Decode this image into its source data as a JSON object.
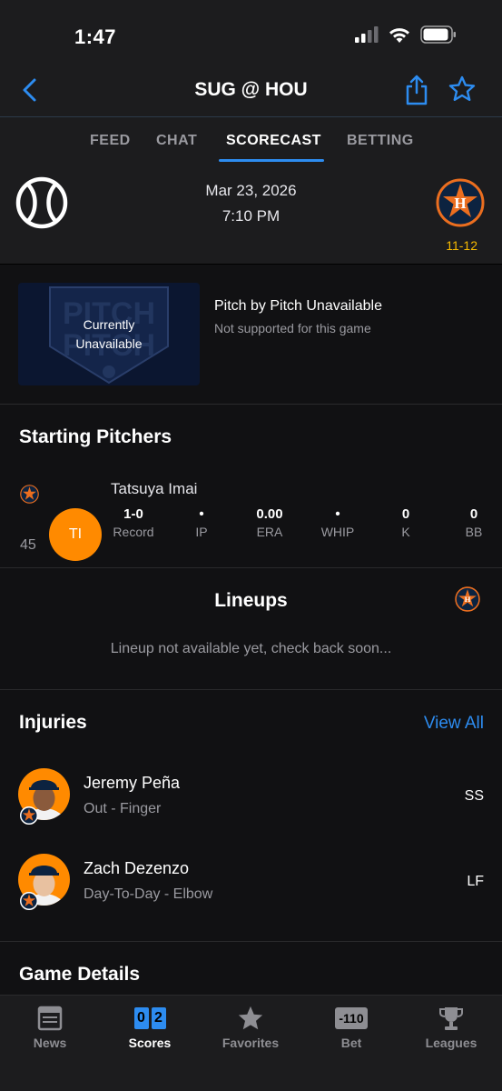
{
  "status_bar": {
    "time": "1:47"
  },
  "nav": {
    "title": "SUG @ HOU"
  },
  "tabs": [
    {
      "label": "FEED"
    },
    {
      "label": "CHAT"
    },
    {
      "label": "SCORECAST"
    },
    {
      "label": "BETTING"
    }
  ],
  "game": {
    "date": "Mar 23, 2026",
    "time": "7:10 PM",
    "home_record": "11-12"
  },
  "pitch_by_pitch": {
    "overlay": "Currently Unavailable",
    "title": "Pitch by Pitch Unavailable",
    "subtitle": "Not supported for this game"
  },
  "starting_pitchers": {
    "heading": "Starting Pitchers",
    "pitcher": {
      "name": "Tatsuya Imai",
      "initials": "TI",
      "number": "45",
      "stats": [
        {
          "value": "1-0",
          "label": "Record"
        },
        {
          "value": "•",
          "label": "IP"
        },
        {
          "value": "0.00",
          "label": "ERA"
        },
        {
          "value": "•",
          "label": "WHIP"
        },
        {
          "value": "0",
          "label": "K"
        },
        {
          "value": "0",
          "label": "BB"
        }
      ]
    }
  },
  "lineups": {
    "heading": "Lineups",
    "message": "Lineup not available yet, check back soon..."
  },
  "injuries": {
    "heading": "Injuries",
    "view_all": "View All",
    "items": [
      {
        "name": "Jeremy Peña",
        "status": "Out - Finger",
        "position": "SS"
      },
      {
        "name": "Zach Dezenzo",
        "status": "Day-To-Day - Elbow",
        "position": "LF"
      }
    ]
  },
  "game_details": {
    "heading": "Game Details"
  },
  "tab_bar": {
    "items": [
      {
        "label": "News",
        "icon": "news-icon"
      },
      {
        "label": "Scores",
        "icon": "scores-icon",
        "digits": [
          "0",
          "2"
        ]
      },
      {
        "label": "Favorites",
        "icon": "star-icon"
      },
      {
        "label": "Bet",
        "icon": "bet-icon",
        "badge": "-110"
      },
      {
        "label": "Leagues",
        "icon": "trophy-icon"
      }
    ]
  },
  "colors": {
    "accent": "#2d8cf0",
    "team_orange": "#ff8a00",
    "record": "#f5b800"
  }
}
